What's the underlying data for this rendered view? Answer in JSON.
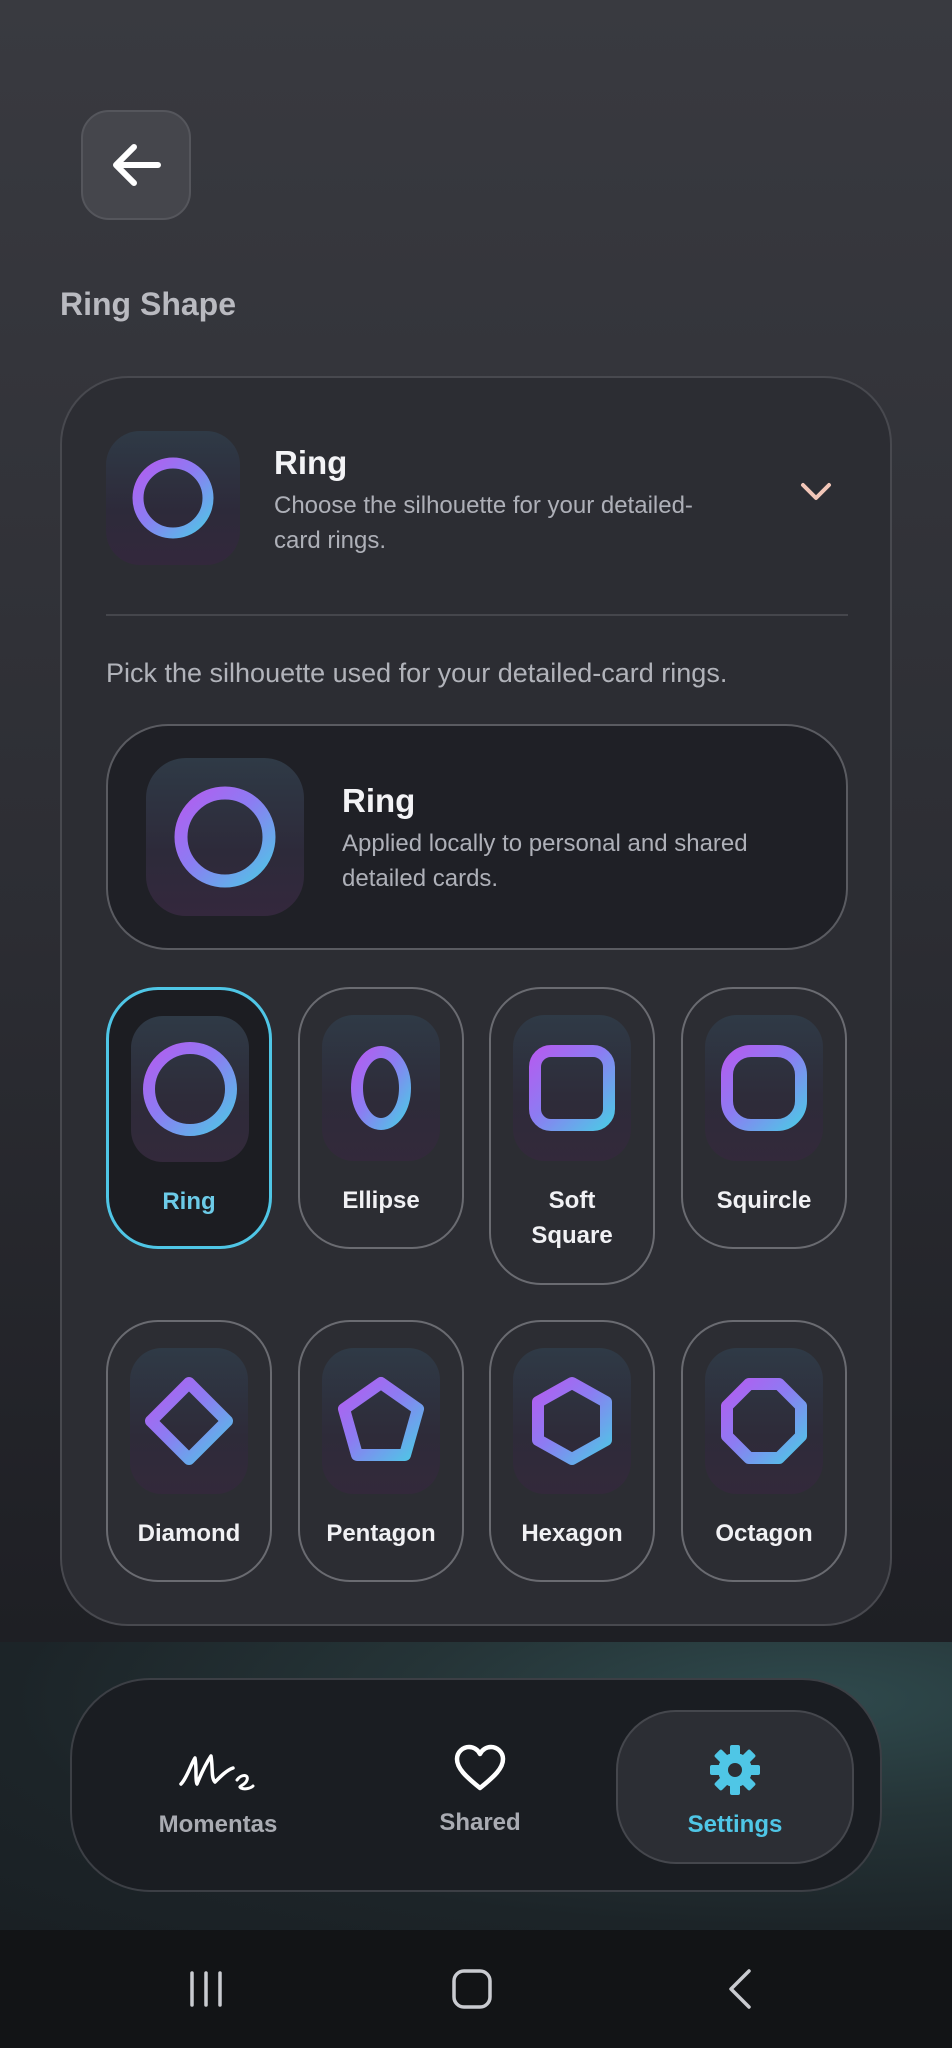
{
  "header": {
    "back_icon": "arrow-left-icon"
  },
  "section_title": "Ring Shape",
  "panel": {
    "title": "Ring",
    "subtitle": "Choose the silhouette for your detailed-card rings.",
    "expand_icon": "chevron-down-icon",
    "description": "Pick the silhouette used for your detailed-card rings.",
    "preview": {
      "title": "Ring",
      "subtitle": "Applied locally to personal and shared detailed cards."
    },
    "options": [
      {
        "label": "Ring",
        "shape": "ring",
        "selected": true
      },
      {
        "label": "Ellipse",
        "shape": "ellipse",
        "selected": false
      },
      {
        "label": "Soft Square",
        "shape": "soft-square",
        "selected": false
      },
      {
        "label": "Squircle",
        "shape": "squircle",
        "selected": false
      },
      {
        "label": "Diamond",
        "shape": "diamond",
        "selected": false
      },
      {
        "label": "Pentagon",
        "shape": "pentagon",
        "selected": false
      },
      {
        "label": "Hexagon",
        "shape": "hexagon",
        "selected": false
      },
      {
        "label": "Octagon",
        "shape": "octagon",
        "selected": false
      }
    ]
  },
  "bottom_nav": {
    "items": [
      {
        "label": "Momentas",
        "icon": "momentas-logo-icon",
        "active": false
      },
      {
        "label": "Shared",
        "icon": "heart-icon",
        "active": false
      },
      {
        "label": "Settings",
        "icon": "gear-icon",
        "active": true
      }
    ]
  },
  "system_nav": {
    "recents_icon": "recents-icon",
    "home_icon": "home-icon",
    "back_icon": "back-icon"
  },
  "colors": {
    "accent": "#4fc6e6",
    "gradient_start": "#b35df0",
    "gradient_end": "#4fc6e6"
  }
}
